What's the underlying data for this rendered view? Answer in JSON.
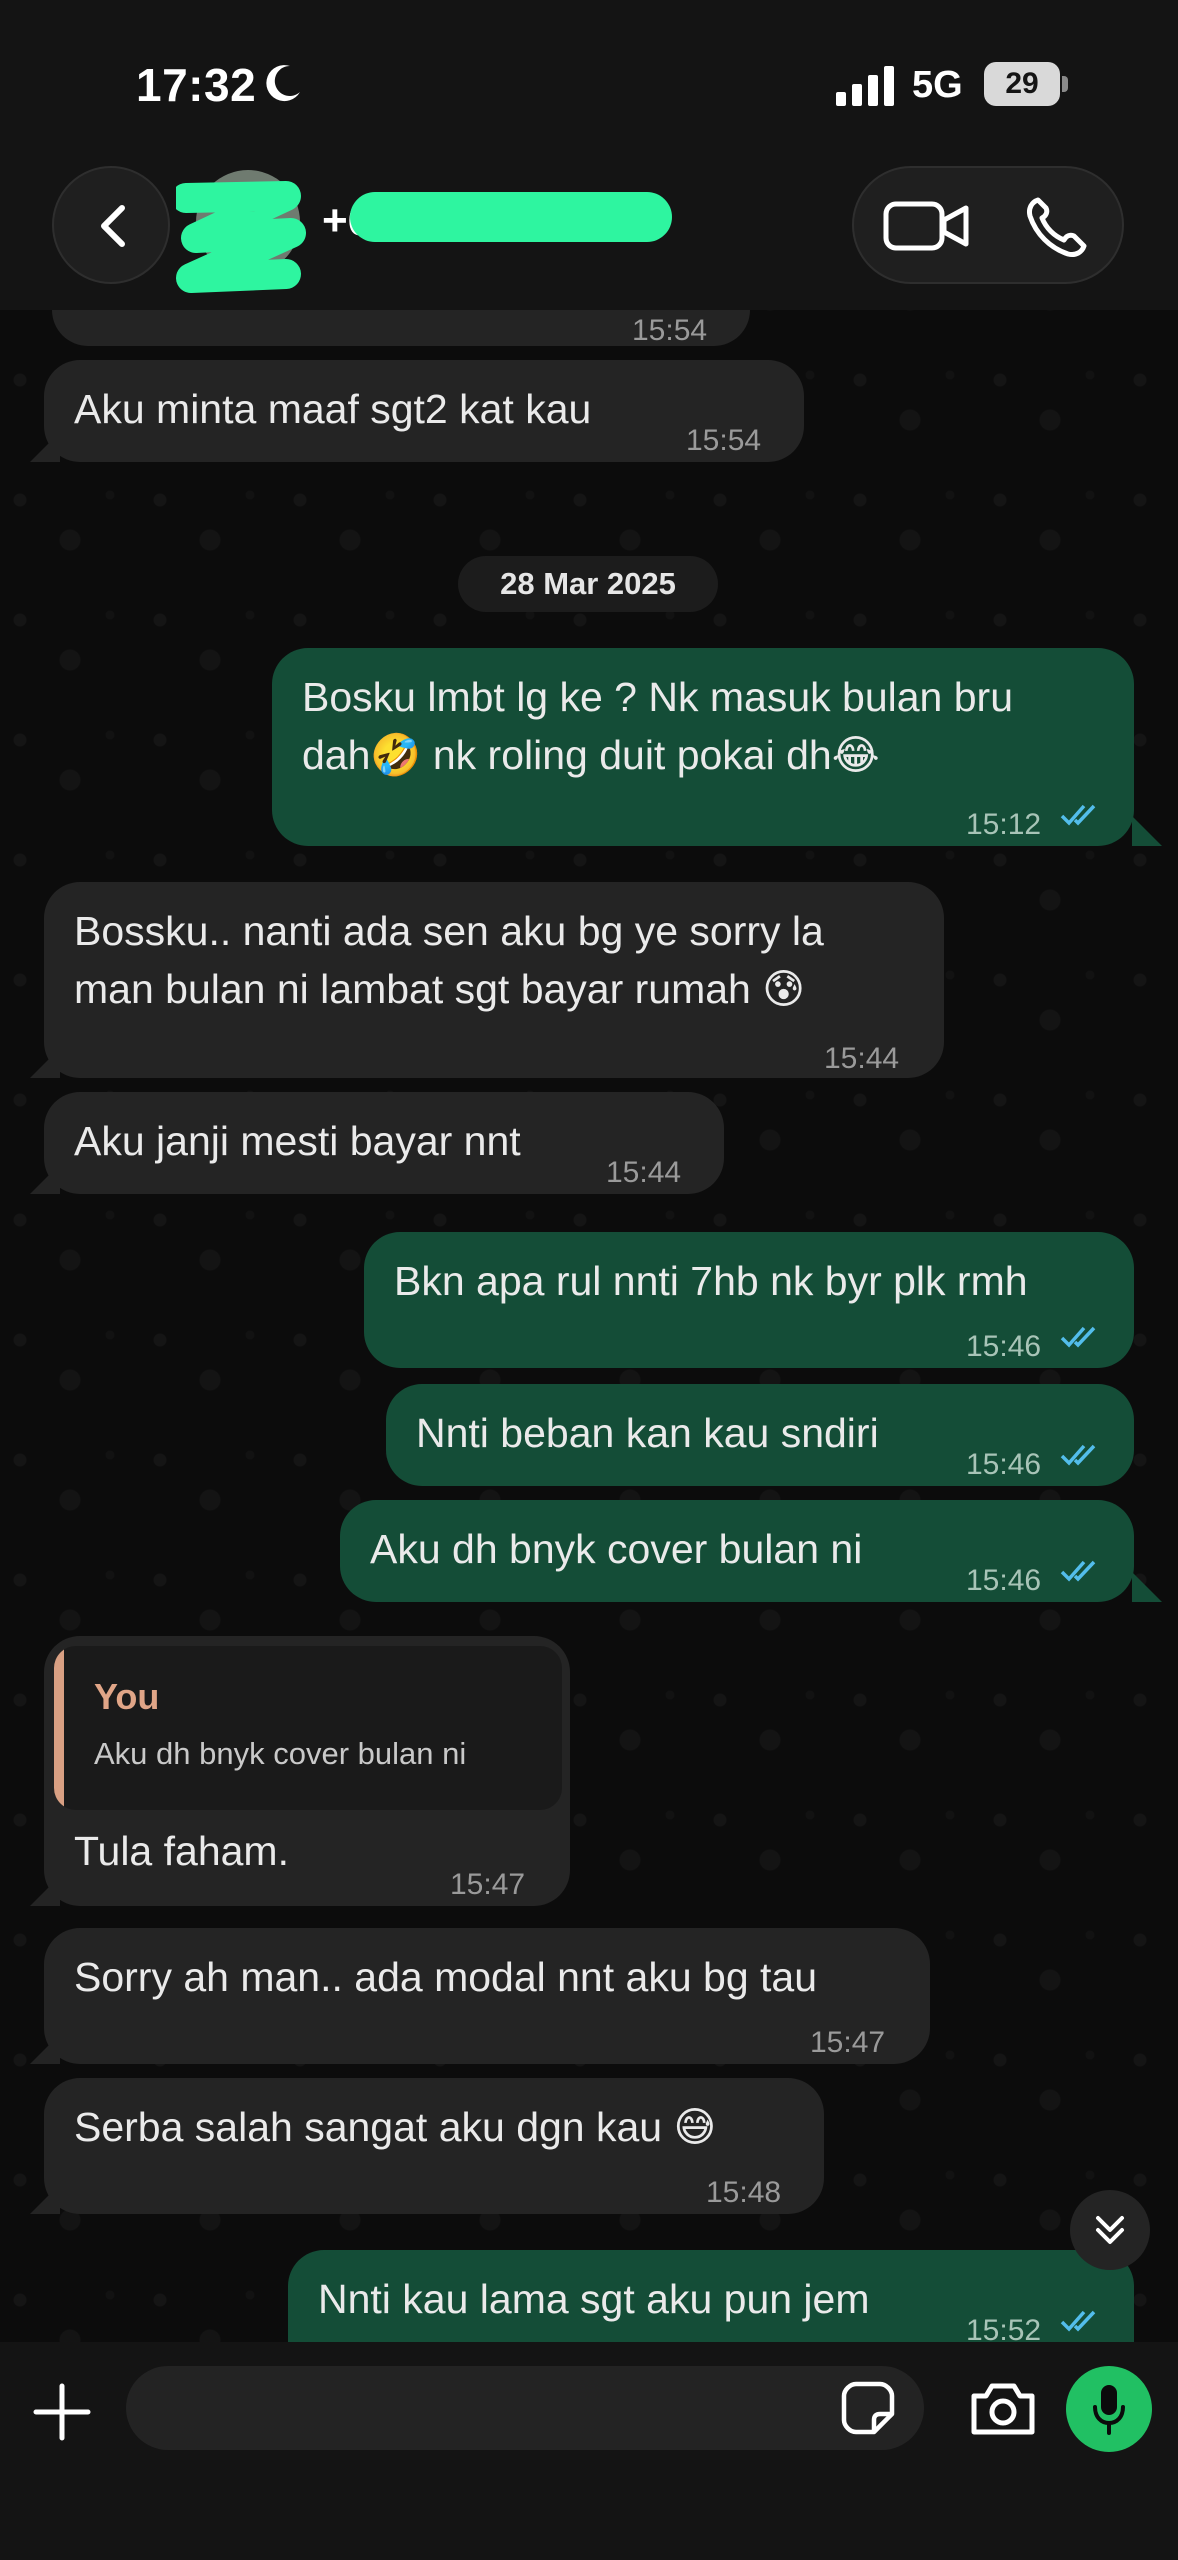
{
  "status_bar": {
    "time": "17:32",
    "network": "5G",
    "battery": "29"
  },
  "header": {
    "contact_name": "+6"
  },
  "messages": {
    "partial_time": "15:54",
    "m1": {
      "text": "Aku minta maaf sgt2 kat kau",
      "time": "15:54"
    },
    "date_separator": "28 Mar 2025",
    "m2": {
      "line1": "Bosku lmbt lg ke ? Nk masuk bulan bru",
      "line2": "dah🤣 nk roling duit pokai dh😂",
      "time": "15:12"
    },
    "m3": {
      "line1": "Bossku.. nanti ada sen aku bg ye sorry la",
      "line2": "man bulan ni lambat sgt bayar rumah 😰",
      "time": "15:44"
    },
    "m4": {
      "text": "Aku janji mesti bayar nnt",
      "time": "15:44"
    },
    "m5": {
      "text": "Bkn apa rul nnti 7hb nk byr plk rmh",
      "time": "15:46"
    },
    "m6": {
      "text": "Nnti beban kan kau sndiri",
      "time": "15:46"
    },
    "m7": {
      "text": "Aku dh  bnyk cover bulan ni",
      "time": "15:46"
    },
    "m8": {
      "quote_author": "You",
      "quote_text": "Aku dh  bnyk cover bulan ni",
      "text": "Tula faham.",
      "time": "15:47"
    },
    "m9": {
      "text": "Sorry ah man.. ada modal nnt aku bg tau",
      "time": "15:47"
    },
    "m10": {
      "text": "Serba salah sangat aku dgn kau 😅",
      "time": "15:48"
    },
    "m11": {
      "text": "Nnti kau lama sgt aku pun jem",
      "time": "15:52"
    }
  },
  "composer": {
    "input_value": ""
  },
  "icons": {
    "back": "chevron-left-icon",
    "video": "video-camera-icon",
    "phone": "phone-icon",
    "plus": "plus-icon",
    "sticker": "sticker-icon",
    "camera": "camera-icon",
    "mic": "microphone-icon",
    "scroll": "double-chevron-down-icon"
  },
  "colors": {
    "outgoing_bubble": "#144d37",
    "incoming_bubble": "#242424",
    "read_ticks": "#53bdeb",
    "mic_button": "#21c063",
    "quote_accent": "#d9a083"
  }
}
